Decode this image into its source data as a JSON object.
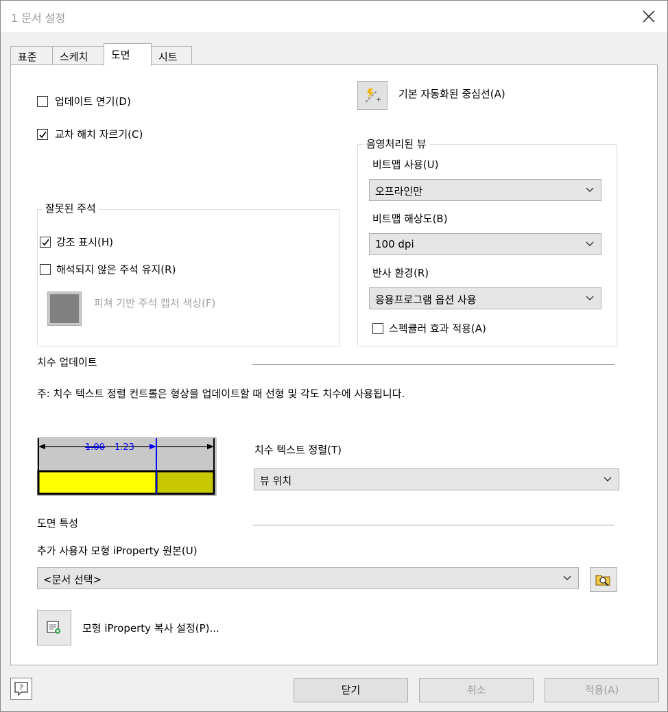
{
  "window": {
    "title": "1 문서 설정"
  },
  "tabs": [
    {
      "label": "표준"
    },
    {
      "label": "스케치"
    },
    {
      "label": "도면",
      "active": true
    },
    {
      "label": "시트"
    }
  ],
  "options": {
    "defer_update": {
      "label": "업데이트 연기(D)",
      "checked": false
    },
    "crop_hatch": {
      "label": "교차 해치 자르기(C)",
      "checked": true
    }
  },
  "auto_centerline": {
    "label": "기본 자동화된 중심선(A)",
    "icon": "auto-centerline-icon"
  },
  "bad_annotations": {
    "title": "잘못된 주석",
    "highlight": {
      "label": "강조 표시(H)",
      "checked": true
    },
    "keep_unresolved": {
      "label": "해석되지 않은 주석 유지(R)",
      "checked": false
    },
    "capture_color_label": "피쳐 기반 주석 캡처 색상(F)",
    "capture_color": "#808080"
  },
  "shaded_views": {
    "title": "음영처리된 뷰",
    "bitmap_use": {
      "label": "비트맵 사용(U)",
      "value": "오프라인만"
    },
    "bitmap_resolution": {
      "label": "비트맵 해상도(B)",
      "value": "100 dpi"
    },
    "reflection_env": {
      "label": "반사 환경(R)",
      "value": "응용프로그램 옵션 사용"
    },
    "specular": {
      "label": "스펙큘러 효과 적용(A)",
      "checked": false
    }
  },
  "dimension_update": {
    "title": "치수 업데이트",
    "note": "주: 치수 텍스트 정렬 컨트롤은 형상을 업데이트할 때 선형 및 각도 치수에 사용됩니다.",
    "preview_old_value": "1.00",
    "preview_new_value": "1.23",
    "text_align": {
      "label": "치수 텍스트 정렬(T)",
      "value": "뷰 위치"
    }
  },
  "drawing_props": {
    "title": "도면 특성",
    "source_label": "추가 사용자 모형 iProperty 원본(U)",
    "source_value": "<문서 선택>",
    "copy_settings_label": "모형 iProperty 복사 설정(P)..."
  },
  "footer": {
    "close": "닫기",
    "cancel": "취소",
    "apply": "적용(A)"
  },
  "colors": {
    "highlight_frame": "#e8000b",
    "preview_yellow": "#ffff00",
    "preview_olive": "#c8c800",
    "preview_blue": "#0000ff"
  }
}
